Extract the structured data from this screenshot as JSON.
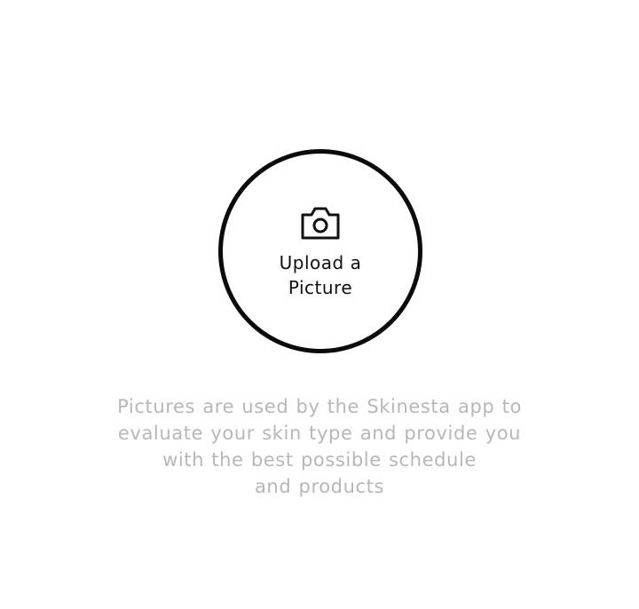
{
  "upload": {
    "label_line1": "Upload a",
    "label_line2": "Picture",
    "icon": "camera-icon"
  },
  "description": {
    "line1": "Pictures are used by the Skinesta app to",
    "line2": "evaluate your skin type and provide you",
    "line3": "with the best possible schedule",
    "line4": "and products"
  },
  "colors": {
    "circle_border": "#0b0b0b",
    "label_text": "#111111",
    "description_text": "#b7b7b7",
    "background": "#ffffff"
  }
}
